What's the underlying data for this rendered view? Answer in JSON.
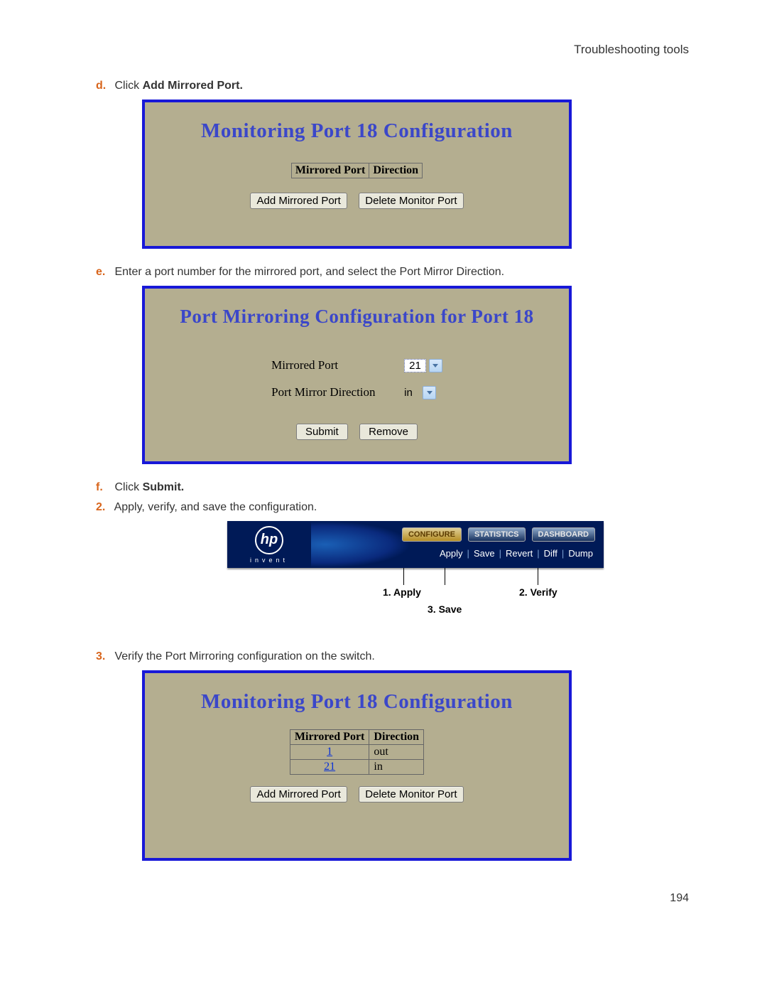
{
  "header": {
    "topic": "Troubleshooting tools"
  },
  "steps": {
    "d": {
      "marker": "d.",
      "prefix": "Click ",
      "bold": "Add Mirrored Port."
    },
    "e": {
      "marker": "e.",
      "text": "Enter a port number for the mirrored port, and select the Port Mirror Direction."
    },
    "f": {
      "marker": "f.",
      "prefix": "Click ",
      "bold": "Submit."
    },
    "s2": {
      "marker": "2.",
      "text": "Apply, verify, and save the configuration."
    },
    "s3": {
      "marker": "3.",
      "text": "Verify the Port Mirroring configuration on the switch."
    }
  },
  "panel_a": {
    "title": "Monitoring Port 18 Configuration",
    "col1": "Mirrored Port",
    "col2": "Direction",
    "btn_add": "Add Mirrored Port",
    "btn_del": "Delete Monitor Port"
  },
  "panel_b": {
    "title": "Port Mirroring Configuration for Port 18",
    "row1_label": "Mirrored Port",
    "row1_value": "21",
    "row2_label": "Port Mirror Direction",
    "row2_value": "in",
    "btn_submit": "Submit",
    "btn_remove": "Remove"
  },
  "hp_bar": {
    "logo_text": "hp",
    "invent": "invent",
    "tabs": {
      "configure": "CONFIGURE",
      "statistics": "STATISTICS",
      "dashboard": "DASHBOARD"
    },
    "subrow": {
      "apply": "Apply",
      "save": "Save",
      "revert": "Revert",
      "diff": "Diff",
      "dump": "Dump"
    },
    "anno_apply": "1. Apply",
    "anno_verify": "2. Verify",
    "anno_save": "3. Save"
  },
  "panel_c": {
    "title": "Monitoring Port 18 Configuration",
    "h1": "Mirrored Port",
    "h2": "Direction",
    "rows": [
      {
        "port": "1",
        "dir": "out"
      },
      {
        "port": "21",
        "dir": "in"
      }
    ],
    "btn_add": "Add Mirrored Port",
    "btn_del": "Delete Monitor Port"
  },
  "page_num": "194"
}
